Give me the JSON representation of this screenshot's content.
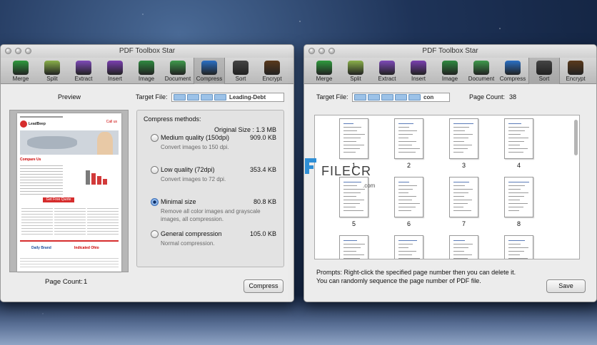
{
  "app_title": "PDF Toolbox Star",
  "toolbar": [
    {
      "label": "Merge",
      "icon": "merge-icon",
      "color": "#2f9a3d"
    },
    {
      "label": "Split",
      "icon": "split-icon",
      "color": "#8ab04a"
    },
    {
      "label": "Extract",
      "icon": "extract-icon",
      "color": "#7e4ab8"
    },
    {
      "label": "Insert",
      "icon": "insert-icon",
      "color": "#7a3fb0"
    },
    {
      "label": "Image",
      "icon": "image-icon",
      "color": "#2f8a40"
    },
    {
      "label": "Document",
      "icon": "document-icon",
      "color": "#3f9a4c"
    },
    {
      "label": "Compress",
      "icon": "compress-icon",
      "color": "#2a6fc4"
    },
    {
      "label": "Sort",
      "icon": "sort-icon",
      "color": "#444444"
    },
    {
      "label": "Encrypt",
      "icon": "lock-icon",
      "color": "#5a3a1c"
    }
  ],
  "left": {
    "active_tool": "Compress",
    "preview_label": "Preview",
    "target_label": "Target File:",
    "target_doc": "Leading-Debt",
    "compress_title": "Compress methods:",
    "original_size": "Original Size : 1.3 MB",
    "options": [
      {
        "title": "Medium quality (150dpi)",
        "size": "909.0 KB",
        "desc": "Convert images to 150 dpi.",
        "selected": false
      },
      {
        "title": "Low quality (72dpi)",
        "size": "353.4 KB",
        "desc": "Convert images to 72 dpi.",
        "selected": false
      },
      {
        "title": "Minimal size",
        "size": "80.8 KB",
        "desc": "Remove all color images and grayscale images, all compression.",
        "selected": true
      },
      {
        "title": "General compression",
        "size": "105.0 KB",
        "desc": "Normal compression.",
        "selected": false
      }
    ],
    "page_count_label": "Page Count:",
    "page_count": "1",
    "compress_button": "Compress",
    "preview_page": {
      "brand": "LeadBeep",
      "call_label": "Call us",
      "heading": "Compare Us",
      "cta": "Get Free Quote",
      "logo_1": "Daily Brand",
      "logo_2": "Indicated Ohio"
    }
  },
  "right": {
    "active_tool": "Sort",
    "target_label": "Target File:",
    "target_doc": "con",
    "page_count_label": "Page Count:",
    "page_count": "38",
    "pages": [
      "1",
      "2",
      "3",
      "4",
      "5",
      "6",
      "7",
      "8"
    ],
    "prompt_line1": "Prompts: Right-click the specified page number then you can delete it.",
    "prompt_line2": "You can randomly sequence the page number of PDF file.",
    "save_button": "Save"
  },
  "watermark": {
    "text": "FILECR",
    "sub": ".com"
  }
}
